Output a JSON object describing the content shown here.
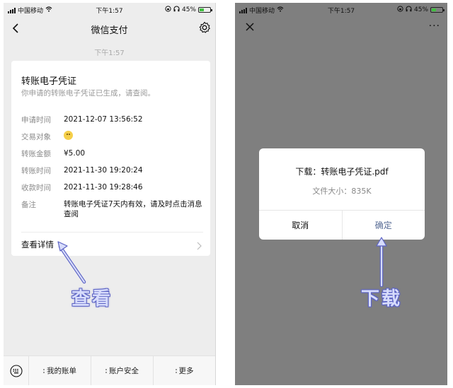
{
  "status": {
    "carrier": "中国移动",
    "time": "下午1:57",
    "battery": "45%",
    "battery_level": 0.45
  },
  "left": {
    "nav_title": "微信支付",
    "timestamp": "下午1:57",
    "card": {
      "title": "转账电子凭证",
      "subtitle": "你申请的转账电子凭证已生成，请查阅。",
      "rows": [
        {
          "key": "申请时间",
          "value": "2021-12-07 13:56:52"
        },
        {
          "key": "交易对象",
          "value": ""
        },
        {
          "key": "转账金额",
          "value": "¥5.00"
        },
        {
          "key": "转账时间",
          "value": "2021-11-30 19:20:24"
        },
        {
          "key": "收款时间",
          "value": "2021-11-30 19:28:46"
        },
        {
          "key": "备注",
          "value": "转账电子凭证7天内有效，请及时点击消息查阅"
        }
      ],
      "detail_link": "查看详情"
    },
    "annotation": "查看",
    "tabbar": {
      "tab1": "我的账单",
      "tab2": "账户安全",
      "tab3": "更多"
    }
  },
  "right": {
    "more": "···",
    "dialog": {
      "title": "下载：转账电子凭证.pdf",
      "size": "文件大小：835K",
      "cancel": "取消",
      "confirm": "确定"
    },
    "annotation": "下载"
  },
  "colors": {
    "accent": "#576b95",
    "annotation_fill": "#d7dcfb",
    "annotation_stroke": "#5c63c4",
    "overlay": "#7f7f7f"
  }
}
